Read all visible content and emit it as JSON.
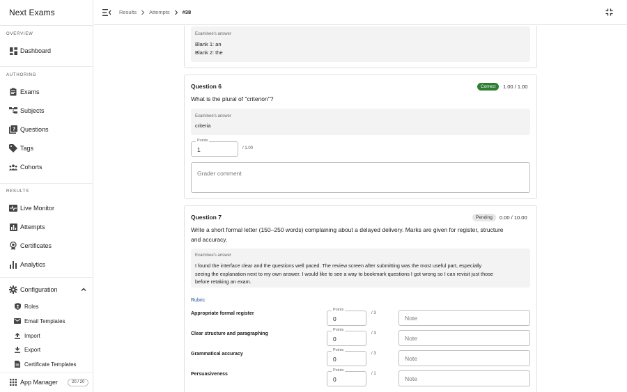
{
  "app": {
    "title": "Next Exams"
  },
  "sidebar": {
    "sections": {
      "overview": "OVERVIEW",
      "authoring": "AUTHORING",
      "results": "RESULTS"
    },
    "items": {
      "dashboard": "Dashboard",
      "exams": "Exams",
      "subjects": "Subjects",
      "questions": "Questions",
      "tags": "Tags",
      "cohorts": "Cohorts",
      "live_monitor": "Live Monitor",
      "attempts": "Attempts",
      "certificates": "Certificates",
      "analytics": "Analytics",
      "configuration": "Configuration",
      "roles": "Roles",
      "email_templates": "Email Templates",
      "import": "Import",
      "export": "Export",
      "certificate_templates": "Certificate Templates",
      "app_manager": "App Manager",
      "app_manager_count": "20 / 20"
    },
    "icons": {
      "dashboard": "dashboard-icon",
      "exams": "clipboard-icon",
      "subjects": "hierarchy-icon",
      "questions": "quiz-icon",
      "tags": "tag-icon",
      "cohorts": "groups-icon",
      "live_monitor": "monitor-heart-icon",
      "attempts": "bar-chart-icon",
      "certificates": "award-icon",
      "analytics": "analytics-icon",
      "configuration": "gear-icon",
      "roles": "shield-icon",
      "email_templates": "mail-icon",
      "import": "upload-icon",
      "export": "download-icon",
      "certificate_templates": "document-icon",
      "app_manager": "grid-icon"
    }
  },
  "breadcrumb": {
    "results": "Results",
    "attempts": "Attempts",
    "current": "#38"
  },
  "answer_label": "Examinee's answer",
  "partial_card": {
    "answer_lines": [
      "Blank 1: an",
      "Blank 2: the"
    ]
  },
  "question6": {
    "title": "Question 6",
    "status": "Correct",
    "score": "1.00 / 1.00",
    "prompt": "What is the plural of \"criterion\"?",
    "answer": "criteria",
    "points_label": "Points",
    "points_value": "1",
    "points_max": "/ 1.00",
    "comment_placeholder": "Grader comment"
  },
  "question7": {
    "title": "Question 7",
    "status": "Pending",
    "score": "0.00 / 10.00",
    "prompt_line1": "Write a short formal letter (150–250 words) complaining about a delayed delivery. Marks are given for register, structure",
    "prompt_line2": "and accuracy.",
    "answer_line1": "I found the interface clear and the questions well paced. The review screen after submitting was the most useful part, especially",
    "answer_line2": "seeing the explanation next to my own answer. I would like to see a way to bookmark questions I got wrong so I can revisit just those",
    "answer_line3": "before retaking an exam.",
    "rubric_label": "Rubric",
    "rubric": [
      {
        "name": "Appropriate formal register",
        "points_label": "Points",
        "points": "0",
        "max": "/ 3",
        "note_placeholder": "Note"
      },
      {
        "name": "Clear structure and paragraphing",
        "points_label": "Points",
        "points": "0",
        "max": "/ 3",
        "note_placeholder": "Note"
      },
      {
        "name": "Grammatical accuracy",
        "points_label": "Points",
        "points": "0",
        "max": "/ 3",
        "note_placeholder": "Note"
      },
      {
        "name": "Persuasiveness",
        "points_label": "Points",
        "points": "0",
        "max": "/ 1",
        "note_placeholder": "Note"
      }
    ]
  },
  "colors": {
    "correct": "#2e7d32",
    "pending": "#e6e6e6",
    "rubric": "#1a4f8b"
  }
}
